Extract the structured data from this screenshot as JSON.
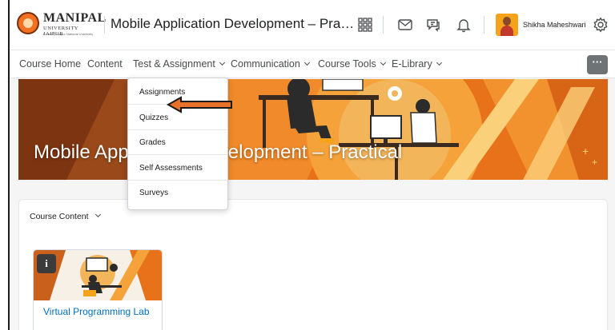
{
  "header": {
    "logo": {
      "name": "MANIPAL",
      "subtitle": "UNIVERSITY JAIPUR",
      "tagline": "Formerly Jaipur National University"
    },
    "course_title": "Mobile Application Development – Pra…",
    "icons": [
      "apps-grid-icon",
      "mail-icon",
      "chat-icon",
      "bell-icon",
      "gear-icon"
    ],
    "user_name": "Shikha Maheshwari"
  },
  "nav": {
    "items": [
      {
        "label": "Course Home",
        "has_menu": false
      },
      {
        "label": "Content",
        "has_menu": false
      },
      {
        "label": "Test & Assignment",
        "has_menu": true
      },
      {
        "label": "Communication",
        "has_menu": true
      },
      {
        "label": "Course Tools",
        "has_menu": true
      },
      {
        "label": "E-Library",
        "has_menu": true
      }
    ],
    "more_label": "···"
  },
  "dropdown": {
    "items": [
      "Assignments",
      "Quizzes",
      "Grades",
      "Self Assessments",
      "Surveys"
    ]
  },
  "banner": {
    "title": "Mobile Application Development – Practical"
  },
  "course_content": {
    "heading": "Course Content",
    "tiles": [
      {
        "title": "Virtual Programming Lab",
        "badge": "i"
      }
    ]
  },
  "colors": {
    "accent_orange": "#f36f21",
    "link_blue": "#006fbf",
    "arrow_orange": "#e8722a"
  }
}
